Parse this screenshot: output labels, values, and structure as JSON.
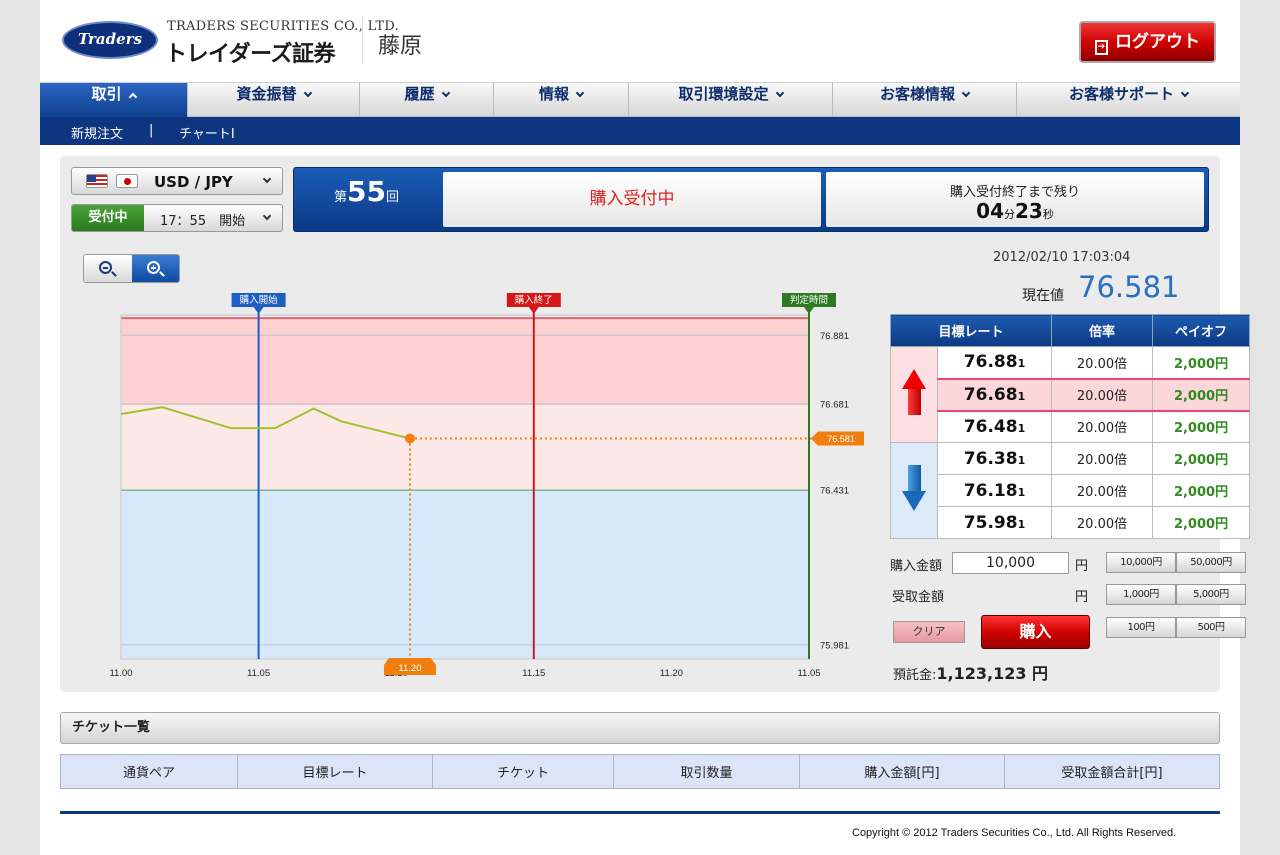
{
  "header": {
    "logo_text": "Traders",
    "company_en": "TRADERS SECURITIES CO., LTD.",
    "company_jp": "トレイダーズ証券",
    "user_name": "藤原",
    "logout_label": "ログアウト"
  },
  "nav": {
    "items": [
      {
        "label": "取引",
        "active": true
      },
      {
        "label": "資金振替",
        "active": false
      },
      {
        "label": "履歴",
        "active": false
      },
      {
        "label": "情報",
        "active": false
      },
      {
        "label": "取引環境設定",
        "active": false
      },
      {
        "label": "お客様情報",
        "active": false
      },
      {
        "label": "お客様サポート",
        "active": false
      }
    ]
  },
  "subnav": {
    "items": [
      "新規注文",
      "|",
      "チャートI"
    ]
  },
  "selector": {
    "pair": "USD / JPY",
    "status": "受付中",
    "time": "17：55　開始"
  },
  "round": {
    "prefix": "第",
    "number": "55",
    "suffix": "回",
    "status": "購入受付中",
    "remain_label": "購入受付終了まで残り",
    "remain_min": "04",
    "min_unit": "分",
    "remain_sec": "23",
    "sec_unit": "秒"
  },
  "quote": {
    "datetime": "2012/02/10  17:03:04",
    "current_label": "現在値",
    "current_value": "76.581"
  },
  "rate_table": {
    "headers": [
      "目標レート",
      "倍率",
      "ペイオフ"
    ],
    "rows": [
      {
        "rate_main": "76.88",
        "rate_small": "1",
        "mult": "20.00倍",
        "payoff": "2,000円"
      },
      {
        "rate_main": "76.68",
        "rate_small": "1",
        "mult": "20.00倍",
        "payoff": "2,000円"
      },
      {
        "rate_main": "76.48",
        "rate_small": "1",
        "mult": "20.00倍",
        "payoff": "2,000円"
      },
      {
        "rate_main": "76.38",
        "rate_small": "1",
        "mult": "20.00倍",
        "payoff": "2,000円"
      },
      {
        "rate_main": "76.18",
        "rate_small": "1",
        "mult": "20.00倍",
        "payoff": "2,000円"
      },
      {
        "rate_main": "75.98",
        "rate_small": "1",
        "mult": "20.00倍",
        "payoff": "2,000円"
      }
    ]
  },
  "order": {
    "amount_label": "購入金額",
    "amount_value": "10,000",
    "yen": "円",
    "receive_label": "受取金額",
    "quick": [
      "10,000円",
      "50,000円",
      "1,000円",
      "5,000円",
      "100円",
      "500円"
    ],
    "clear_label": "クリア",
    "buy_label": "購入",
    "deposit_label": "預託金:",
    "deposit_value": "1,123,123 円"
  },
  "chart_data": {
    "type": "line",
    "x_ticks": [
      "11.00",
      "11.05",
      "11.10",
      "11.15",
      "11.20",
      "11.05"
    ],
    "y_ticks": [
      "76.881",
      "76.681",
      "76.431",
      "75.981"
    ],
    "ylim": [
      75.94,
      76.94
    ],
    "series": [
      {
        "x": [
          0,
          1.5,
          4,
          5.6,
          7,
          8,
          10.5
        ],
        "values": [
          76.652,
          76.672,
          76.611,
          76.611,
          76.668,
          76.631,
          76.581
        ]
      }
    ],
    "current": {
      "x": 10.5,
      "value": 76.581,
      "label": "76.581",
      "x_label": "11.20"
    },
    "markers": [
      {
        "label": "購入開始",
        "x": 5,
        "color": "#1f5fc3"
      },
      {
        "label": "購入終了",
        "x": 15,
        "color": "#d41818"
      },
      {
        "label": "判定時間",
        "x": 25,
        "color": "#2c7a24"
      }
    ],
    "bands": {
      "high_upper": 76.931,
      "high_mid": 76.681,
      "low_mid": 76.431
    }
  },
  "tickets": {
    "title": "チケット一覧",
    "headers": [
      "通貨ペア",
      "目標レート",
      "チケット",
      "取引数量",
      "購入金額[円]",
      "受取金額合計[円]"
    ]
  },
  "footer": {
    "copyright": "Copyright © 2012 Traders Securities Co., Ltd. All Rights Reserved."
  }
}
